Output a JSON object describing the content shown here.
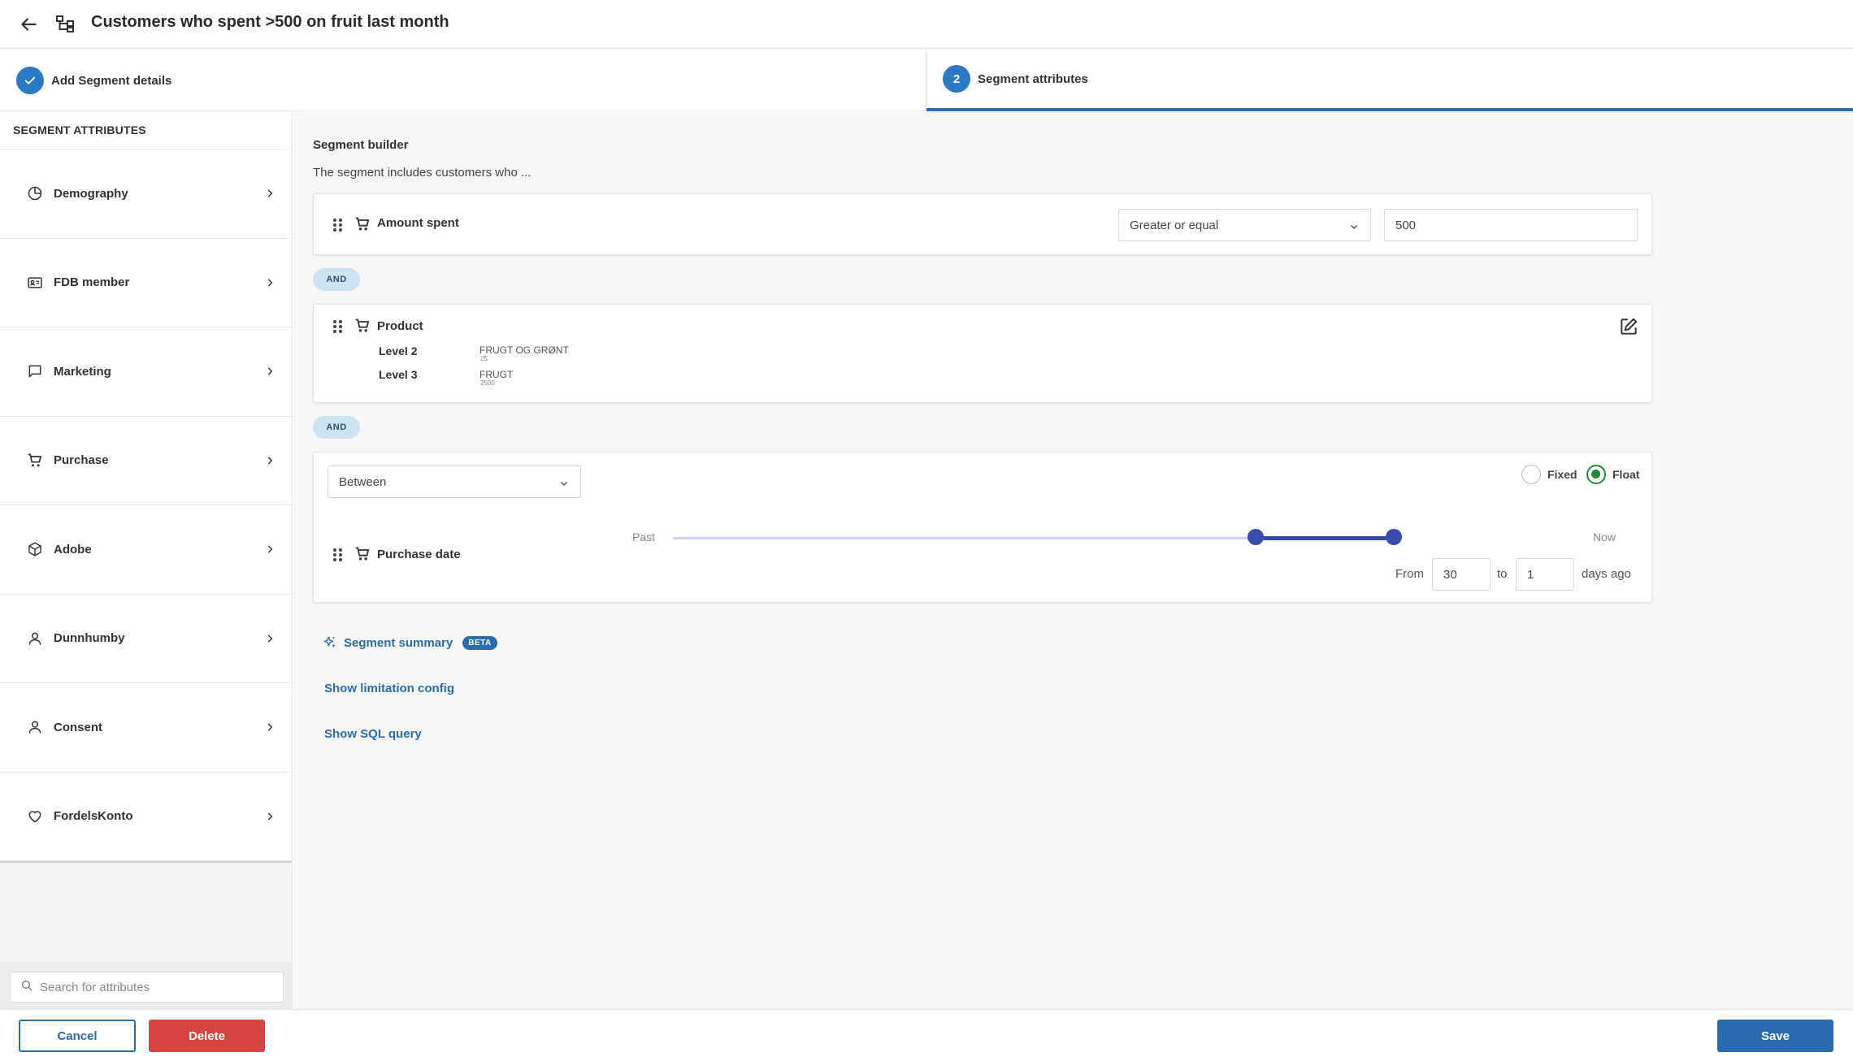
{
  "header": {
    "title": "Customers who spent >500 on fruit last month",
    "back_icon": "arrow-left-icon",
    "segment_icon": "hierarchy-icon"
  },
  "stepper": {
    "steps": [
      {
        "label": "Add Segment details",
        "status": "complete",
        "marker": "check-icon"
      },
      {
        "label": "Segment attributes",
        "status": "active",
        "marker": "2"
      }
    ]
  },
  "sidebar": {
    "heading": "SEGMENT ATTRIBUTES",
    "items": [
      {
        "label": "Demography",
        "icon": "pie-chart-icon"
      },
      {
        "label": "FDB member",
        "icon": "id-card-icon"
      },
      {
        "label": "Marketing",
        "icon": "chat-bubble-icon"
      },
      {
        "label": "Purchase",
        "icon": "cart-icon"
      },
      {
        "label": "Adobe",
        "icon": "cube-icon"
      },
      {
        "label": "Dunnhumby",
        "icon": "person-icon"
      },
      {
        "label": "Consent",
        "icon": "person-icon"
      },
      {
        "label": "FordelsKonto",
        "icon": "heart-icon"
      }
    ],
    "search": {
      "placeholder": "Search for attributes",
      "value": ""
    }
  },
  "builder": {
    "title": "Segment builder",
    "subtitle": "The segment includes customers who ...",
    "conditions": {
      "amount": {
        "label": "Amount spent",
        "operator": "Greater or equal",
        "value": "500"
      },
      "product": {
        "label": "Product",
        "levels": [
          {
            "key": "Level 2",
            "value": "FRUGT OG GRØNT",
            "code": "25"
          },
          {
            "key": "Level 3",
            "value": "FRUGT",
            "code": "2500"
          }
        ]
      },
      "date": {
        "label": "Purchase date",
        "range_mode": "Between",
        "mode_options": [
          {
            "label": "Fixed",
            "selected": false
          },
          {
            "label": "Float",
            "selected": true
          }
        ],
        "slider": {
          "left_label": "Past",
          "right_label": "Now",
          "range_start_fraction": 0.8,
          "range_end_fraction": 0.99
        },
        "from_label": "From",
        "from_value": "30",
        "to_label": "to",
        "to_value": "1",
        "suffix": "days ago"
      }
    },
    "joiner": "AND",
    "links": {
      "summary": "Segment summary",
      "beta": "BETA",
      "limitation": "Show limitation config",
      "sql": "Show SQL query"
    }
  },
  "footer": {
    "cancel": "Cancel",
    "delete": "Delete",
    "save": "Save"
  },
  "colors": {
    "primary": "#2b6cb0",
    "danger": "#d64541",
    "slider": "#3a4bb0",
    "radio_on": "#1f8a3a",
    "and_badge": "#cce4f2"
  }
}
